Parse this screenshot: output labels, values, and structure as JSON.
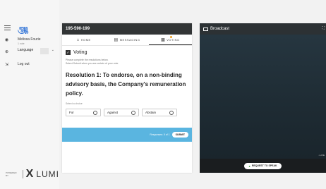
{
  "sidebar": {
    "brand_small": "",
    "brand_glyph": "꧃",
    "user_name": "Melissa Fourie",
    "user_sub": "1 vote",
    "language_label": "Language",
    "logout_label": "Log out",
    "powered_by": "POWERED BY",
    "lumi_mark": "X",
    "lumi_text": "LUMI"
  },
  "meeting": {
    "id": "195-590-199",
    "tabs": [
      {
        "label": "HOME",
        "icon": "home-icon"
      },
      {
        "label": "MESSAGING",
        "icon": "messaging-icon"
      },
      {
        "label": "VOTING",
        "icon": "voting-icon",
        "active": true
      }
    ],
    "section_title": "Voting",
    "instructions_1": "Please complete the resolutions below.",
    "instructions_2": "Select Submit when you are certain of your vote.",
    "resolution": "Resolution 1: To endorse, on a non-binding advisory basis, the Company's remuneration policy.",
    "choice_label": "Select a choice",
    "choices": [
      "For",
      "Against",
      "Abstain"
    ],
    "responses": "Responses: 0 of 1",
    "submit_label": "SUBMIT",
    "colors": {
      "submit_bar": "#5ab5e0",
      "header": "#323536"
    }
  },
  "broadcast": {
    "title": "Broadcast",
    "live_label": "• LIVE",
    "request_label": "REQUEST TO SPEAK"
  }
}
